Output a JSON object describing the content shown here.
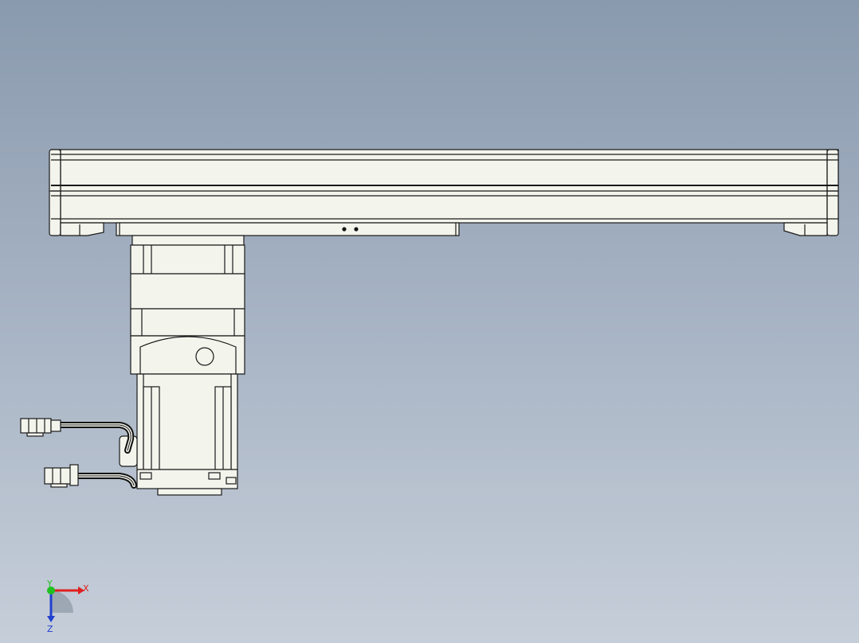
{
  "viewport": {
    "background_top": "#8a9aae",
    "background_bottom": "#c6ced9"
  },
  "model": {
    "part_fill": "#f3f4ec",
    "edge_color": "#1a1a1a",
    "cable_color": "#111111"
  },
  "triad": {
    "x_label": "X",
    "y_label": "Y",
    "z_label": "Z",
    "x_color": "#e02020",
    "y_color": "#20c020",
    "z_color": "#2040d0"
  }
}
